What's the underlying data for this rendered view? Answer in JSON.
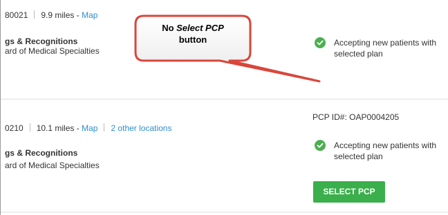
{
  "results": [
    {
      "zip_fragment": "80021",
      "distance": "9.9 miles",
      "map_label": "Map",
      "other_locations": "",
      "section_heading": "gs & Recognitions",
      "board_text": "ard of Medical Specialties",
      "pcp_id": "",
      "accepting_line1": "Accepting new patients with",
      "accepting_line2": "selected plan",
      "select_label": ""
    },
    {
      "zip_fragment": "0210",
      "distance": "10.1 miles",
      "map_label": "Map",
      "other_locations": "2 other locations",
      "section_heading": "gs & Recognitions",
      "board_text": "ard of Medical Specialties",
      "pcp_id": "PCP ID#: OAP0004205",
      "accepting_line1": "Accepting new patients with",
      "accepting_line2": "selected plan",
      "select_label": "SELECT PCP"
    }
  ],
  "callout": {
    "prefix": "No ",
    "emphasis": "Select PCP",
    "line2": "button"
  },
  "colors": {
    "link": "#2d8fcf",
    "check_green": "#4caf50",
    "button_green": "#3aaf4b",
    "callout_border": "#d9463b"
  },
  "icons": {
    "accepting": "check-circle-icon"
  }
}
